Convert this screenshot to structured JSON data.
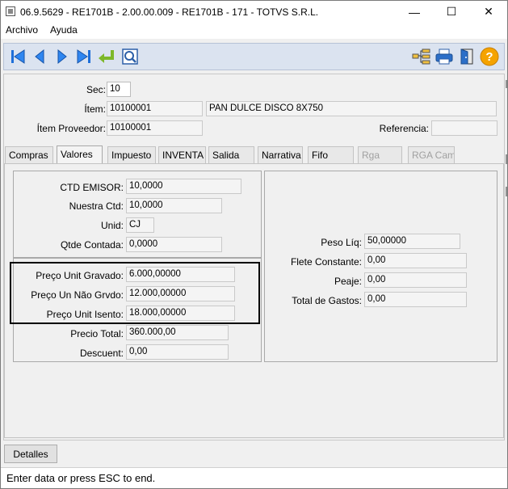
{
  "window": {
    "title": "06.9.5629 - RE1701B - 2.00.00.009 - RE1701B - 171 - TOTVS S.R.L.",
    "minimize": "—",
    "maximize": "☐",
    "close": "✕"
  },
  "menu": {
    "archivo": "Archivo",
    "ayuda": "Ayuda"
  },
  "header": {
    "sec_label": "Sec:",
    "sec_value": "10",
    "item_label": "Ítem:",
    "item_value": "10100001",
    "item_desc": "PAN DULCE DISCO 8X750",
    "prov_label": "Ítem Proveedor:",
    "prov_value": "10100001",
    "ref_label": "Referencia:",
    "ref_value": ""
  },
  "tabs": [
    "Compras",
    "Valores",
    "Impuesto",
    "INVENTA",
    "Salida",
    "Narrativa",
    "Fifo",
    "Rga",
    "RGA Cam"
  ],
  "left": {
    "ctd_emisor_label": "CTD EMISOR:",
    "ctd_emisor_value": "10,0000",
    "nuestra_label": "Nuestra Ctd:",
    "nuestra_value": "10,0000",
    "unid_label": "Unid:",
    "unid_value": "CJ",
    "qtde_label": "Qtde Contada:",
    "qtde_value": "0,0000",
    "grav_label": "Preço Unit Gravado:",
    "grav_value": "6.000,00000",
    "nograv_label": "Preço Un Não Grvdo:",
    "nograv_value": "12.000,00000",
    "isento_label": "Preço Unit Isento:",
    "isento_value": "18.000,00000",
    "total_label": "Precio Total:",
    "total_value": "360.000,00",
    "desc_label": "Descuent:",
    "desc_value": "0,00"
  },
  "right": {
    "peso_label": "Peso Líq:",
    "peso_value": "50,00000",
    "flete_label": "Flete Constante:",
    "flete_value": "0,00",
    "peaje_label": "Peaje:",
    "peaje_value": "0,00",
    "gastos_label": "Total de Gastos:",
    "gastos_value": "0,00"
  },
  "detalles": "Detalles",
  "status": "Enter data or press ESC to end.",
  "colors": {
    "toolbar_bg": "#dbe3f0",
    "nav_blue": "#1e6fd9",
    "help_orange": "#f5a300"
  }
}
